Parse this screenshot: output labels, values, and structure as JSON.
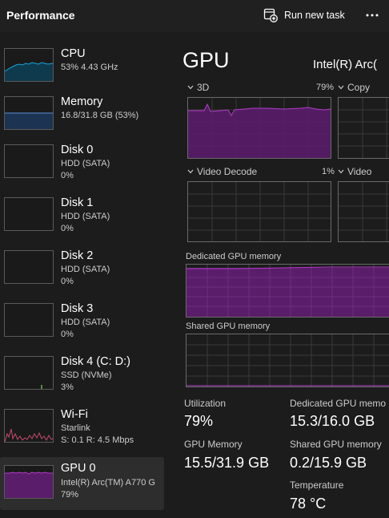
{
  "header": {
    "title": "Performance",
    "run_new_task": "Run new task"
  },
  "sidebar": {
    "items": [
      {
        "name": "CPU",
        "sub1": "53% 4.43 GHz",
        "sub2": ""
      },
      {
        "name": "Memory",
        "sub1": "16.8/31.8 GB (53%)",
        "sub2": ""
      },
      {
        "name": "Disk 0",
        "sub1": "HDD (SATA)",
        "sub2": "0%"
      },
      {
        "name": "Disk 1",
        "sub1": "HDD (SATA)",
        "sub2": "0%"
      },
      {
        "name": "Disk 2",
        "sub1": "HDD (SATA)",
        "sub2": "0%"
      },
      {
        "name": "Disk 3",
        "sub1": "HDD (SATA)",
        "sub2": "0%"
      },
      {
        "name": "Disk 4 (C: D:)",
        "sub1": "SSD (NVMe)",
        "sub2": "3%"
      },
      {
        "name": "Wi-Fi",
        "sub1": "Starlink",
        "sub2": "S: 0.1  R: 4.5 Mbps"
      },
      {
        "name": "GPU 0",
        "sub1": "Intel(R) Arc(TM) A770 G",
        "sub2": "79%"
      }
    ]
  },
  "main": {
    "title": "GPU",
    "model": "Intel(R) Arc(",
    "graphs": {
      "three_d": {
        "label": "3D",
        "pct": "79%"
      },
      "copy": {
        "label": "Copy"
      },
      "video_decode": {
        "label": "Video Decode",
        "pct": "1%"
      },
      "video": {
        "label": "Video"
      }
    },
    "dedicated_memory_label": "Dedicated GPU memory",
    "shared_memory_label": "Shared GPU memory",
    "stats": {
      "utilization_label": "Utilization",
      "utilization_value": "79%",
      "dedicated_label": "Dedicated GPU memo",
      "dedicated_value": "15.3/16.0 GB",
      "gpu_memory_label": "GPU Memory",
      "gpu_memory_value": "15.5/31.9 GB",
      "shared_label": "Shared GPU memory",
      "shared_value": "0.2/15.9 GB",
      "temperature_label": "Temperature",
      "temperature_value": "78 °C"
    }
  },
  "colors": {
    "cpu_accent": "#17a3d8",
    "memory_accent": "#5b8ed6",
    "disk4_accent": "#6ab04c",
    "wifi_accent": "#c24a6e",
    "gpu_accent": "#b23cc8",
    "gpu_fill": "#5a1d6a"
  }
}
